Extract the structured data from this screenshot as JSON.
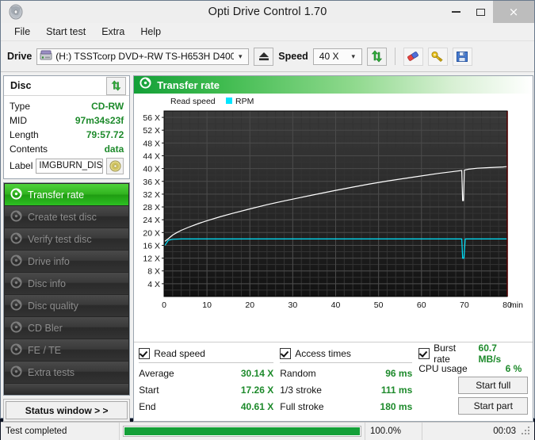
{
  "window": {
    "title": "Opti Drive Control 1.70",
    "icon": "disc-icon",
    "buttons": {
      "minimize": "minimize-icon",
      "maximize": "maximize-icon",
      "close": "×"
    }
  },
  "menu": {
    "items": [
      "File",
      "Start test",
      "Extra",
      "Help"
    ]
  },
  "toolbar": {
    "drive_label": "Drive",
    "drive_value": "(H:)  TSSTcorp DVD+-RW TS-H653H D400",
    "eject_icon": "eject-icon",
    "speed_label": "Speed",
    "speed_value": "40 X",
    "refresh_icon": "refresh-icon",
    "eraser_icon": "eraser-icon",
    "tools_icon": "tools-icon",
    "save_icon": "save-icon"
  },
  "disc_panel": {
    "title": "Disc",
    "refresh_icon": "refresh-icon",
    "rows": [
      {
        "key": "Type",
        "value": "CD-RW"
      },
      {
        "key": "MID",
        "value": "97m34s23f"
      },
      {
        "key": "Length",
        "value": "79:57.72"
      },
      {
        "key": "Contents",
        "value": "data"
      }
    ],
    "label_key": "Label",
    "label_value": "IMGBURN_DIS",
    "label_button_icon": "disc-icon"
  },
  "nav": {
    "items": [
      {
        "label": "Transfer rate",
        "icon": "disc-test-icon",
        "active": true
      },
      {
        "label": "Create test disc",
        "icon": "disc-test-icon",
        "active": false
      },
      {
        "label": "Verify test disc",
        "icon": "disc-test-icon",
        "active": false
      },
      {
        "label": "Drive info",
        "icon": "disc-test-icon",
        "active": false
      },
      {
        "label": "Disc info",
        "icon": "disc-test-icon",
        "active": false
      },
      {
        "label": "Disc quality",
        "icon": "disc-test-icon",
        "active": false
      },
      {
        "label": "CD Bler",
        "icon": "disc-test-icon",
        "active": false
      },
      {
        "label": "FE / TE",
        "icon": "disc-test-icon",
        "active": false
      },
      {
        "label": "Extra tests",
        "icon": "disc-test-icon",
        "active": false
      }
    ],
    "status_window": "Status window > >"
  },
  "chart_header": {
    "title": "Transfer rate",
    "icon": "disc-test-icon"
  },
  "chart_data": {
    "type": "line",
    "title": "Transfer rate",
    "xlabel": "min",
    "ylabel": "X",
    "xlim": [
      0,
      80
    ],
    "ylim": [
      0,
      58
    ],
    "xticks": [
      0,
      10,
      20,
      30,
      40,
      50,
      60,
      70,
      80
    ],
    "xtick_labels": [
      "0",
      "10",
      "20",
      "30",
      "40",
      "50",
      "60",
      "70",
      "80"
    ],
    "x_unit_label": "min",
    "yticks": [
      4,
      8,
      12,
      16,
      20,
      24,
      28,
      32,
      36,
      40,
      44,
      48,
      52,
      56
    ],
    "ytick_labels": [
      "4 X",
      "8 X",
      "12 X",
      "16 X",
      "20 X",
      "24 X",
      "28 X",
      "32 X",
      "36 X",
      "40 X",
      "44 X",
      "48 X",
      "52 X",
      "56 X"
    ],
    "grid": true,
    "plot_bg": "#1d1d1d",
    "grid_color": "#3c3c3c",
    "legend_position": "top-left",
    "legend": [
      {
        "name": "Read speed",
        "color": "#ffffff",
        "swatch": false
      },
      {
        "name": "RPM",
        "color": "#00e5ff",
        "swatch": true
      }
    ],
    "end_marker_color": "#d40000",
    "end_marker_x": 80,
    "series": [
      {
        "name": "Read speed",
        "color": "#ffffff",
        "x": [
          0.2,
          1,
          2,
          3,
          4,
          6,
          8,
          10,
          13,
          16,
          20,
          24,
          28,
          32,
          36,
          40,
          44,
          48,
          52,
          56,
          60,
          64,
          67,
          69.4,
          69.6,
          69.8,
          70.0,
          70.3,
          71,
          73,
          76,
          79,
          79.9
        ],
        "y": [
          17.26,
          18.1,
          19.2,
          20.0,
          20.7,
          21.8,
          22.8,
          23.7,
          24.9,
          26.0,
          27.4,
          28.7,
          29.9,
          31.0,
          32.1,
          33.2,
          34.2,
          35.2,
          36.1,
          36.9,
          37.7,
          38.5,
          39.0,
          39.4,
          30.0,
          30.0,
          39.5,
          39.6,
          39.8,
          40.1,
          40.3,
          40.5,
          40.61
        ]
      },
      {
        "name": "RPM",
        "color": "#00e5ff",
        "x": [
          0.2,
          1,
          2,
          4,
          8,
          14,
          20,
          28,
          36,
          44,
          52,
          60,
          66,
          69.4,
          69.6,
          69.9,
          70.2,
          71,
          76,
          79.9
        ],
        "y": [
          16.0,
          17.6,
          17.9,
          18.0,
          18.0,
          18.0,
          18.0,
          18.0,
          18.0,
          18.0,
          18.0,
          18.0,
          18.0,
          18.0,
          12.0,
          12.0,
          18.0,
          18.0,
          18.0,
          18.0
        ]
      }
    ]
  },
  "results": {
    "read_speed": {
      "checked": true,
      "title": "Read speed",
      "rows": [
        {
          "key": "Average",
          "value": "30.14 X"
        },
        {
          "key": "Start",
          "value": "17.26 X"
        },
        {
          "key": "End",
          "value": "40.61 X"
        }
      ]
    },
    "access_times": {
      "checked": true,
      "title": "Access times",
      "rows": [
        {
          "key": "Random",
          "value": "96 ms"
        },
        {
          "key": "1/3 stroke",
          "value": "111 ms"
        },
        {
          "key": "Full stroke",
          "value": "180 ms"
        }
      ]
    },
    "burst": {
      "checked": true,
      "title": "Burst rate",
      "value": "60.7 MB/s",
      "cpu_key": "CPU usage",
      "cpu_value": "6 %",
      "start_full": "Start full",
      "start_part": "Start part"
    }
  },
  "statusbar": {
    "message": "Test completed",
    "progress_percent": 100,
    "progress_text": "100.0%",
    "time": "00:03"
  }
}
